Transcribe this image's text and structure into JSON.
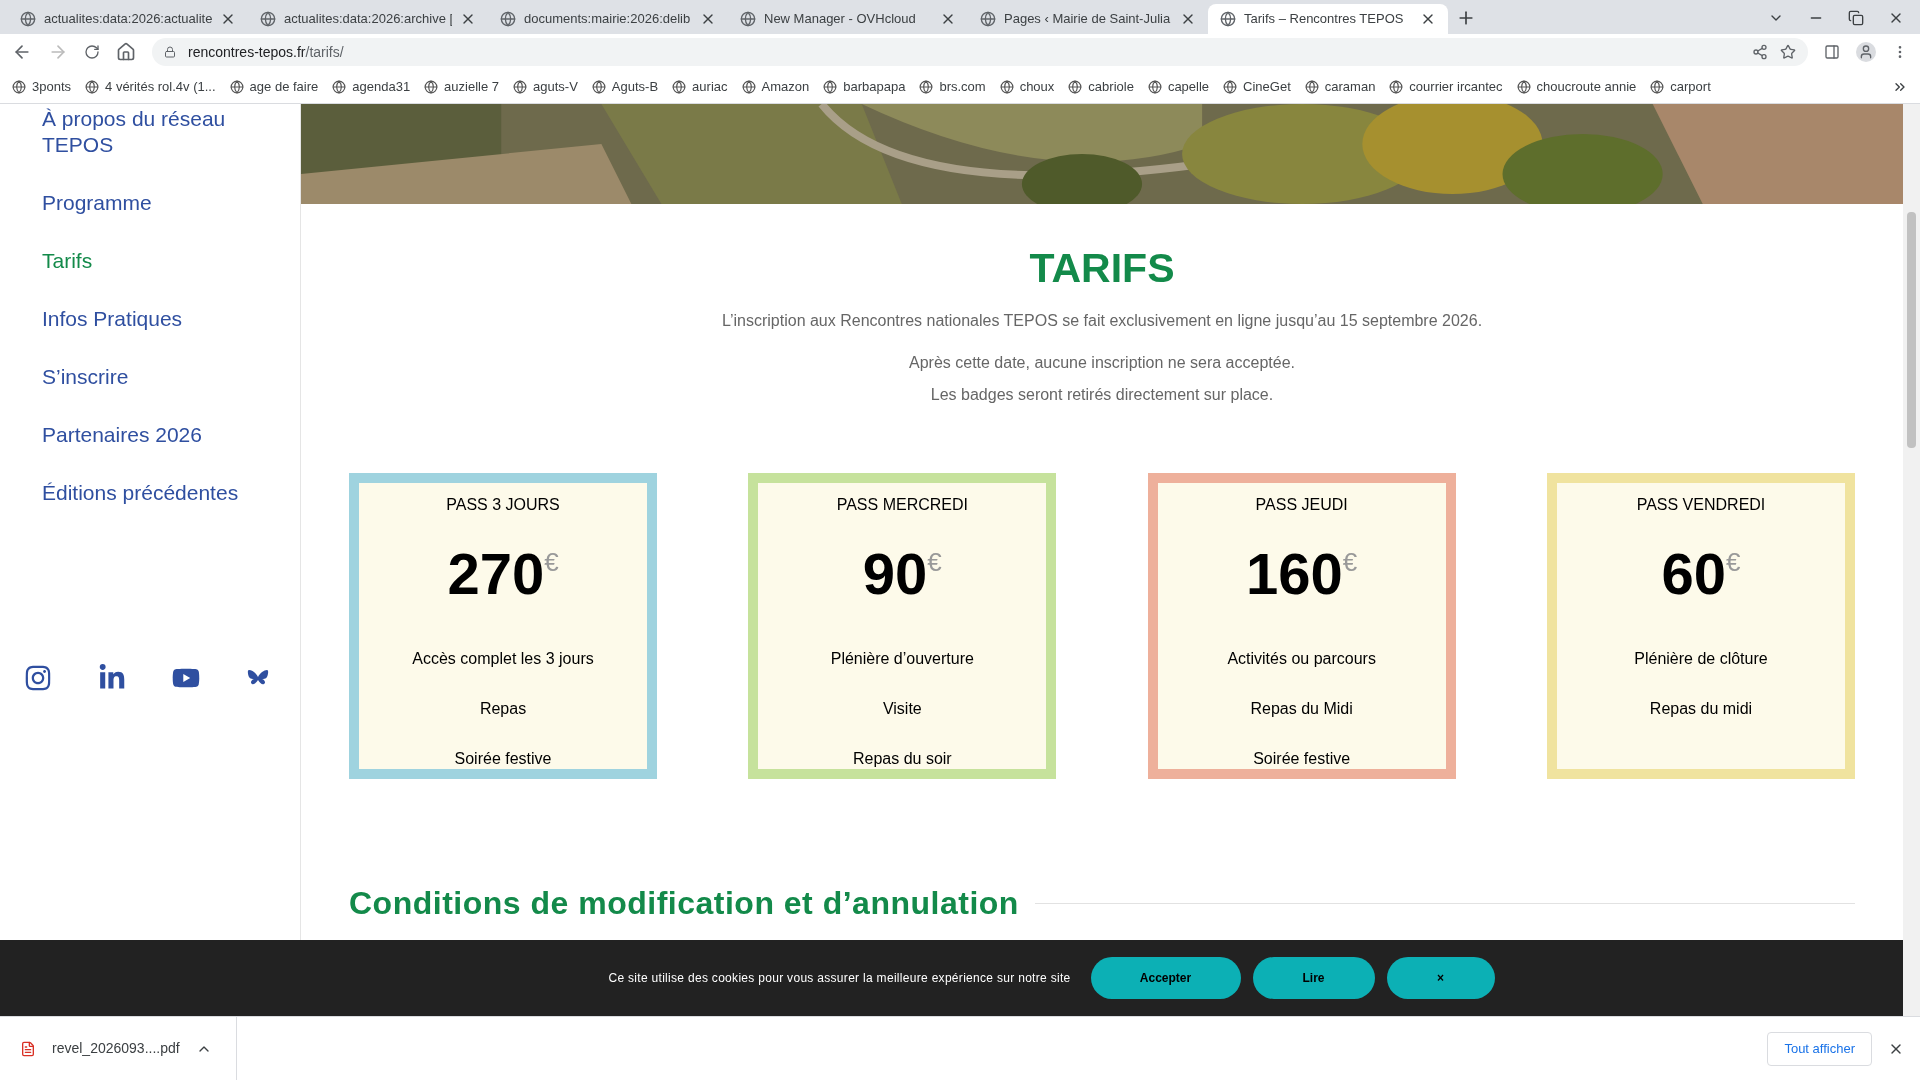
{
  "browser": {
    "tabs": [
      {
        "title": "actualites:data:2026:actualite",
        "selected": false
      },
      {
        "title": "actualites:data:2026:archive [",
        "selected": false
      },
      {
        "title": "documents:mairie:2026:delib",
        "selected": false
      },
      {
        "title": "New Manager - OVHcloud",
        "selected": false
      },
      {
        "title": "Pages ‹ Mairie de Saint-Julia",
        "selected": false
      },
      {
        "title": "Tarifs – Rencontres TEPOS",
        "selected": true
      }
    ],
    "url_host": "rencontres-tepos.fr",
    "url_path": "/tarifs/",
    "bookmarks": [
      "3ponts",
      "4 vérités rol.4v  (1...",
      "age de faire",
      "agenda31",
      "auzielle 7",
      "aguts-V",
      "Aguts-B",
      "auriac",
      "Amazon",
      "barbapapa",
      "brs.com",
      "choux",
      "cabriole",
      "capelle",
      "CineGet",
      "caraman",
      "courrier ircantec",
      "choucroute annie",
      "carport"
    ]
  },
  "sidebar": {
    "items": [
      {
        "label": "À propos du réseau TEPOS",
        "selected": false
      },
      {
        "label": "Programme",
        "selected": false
      },
      {
        "label": "Tarifs",
        "selected": true
      },
      {
        "label": "Infos Pratiques",
        "selected": false
      },
      {
        "label": "S’inscrire",
        "selected": false
      },
      {
        "label": "Partenaires 2026",
        "selected": false
      },
      {
        "label": "Éditions précédentes",
        "selected": false
      }
    ],
    "social": [
      {
        "kind": "instagram"
      },
      {
        "kind": "linkedin"
      },
      {
        "kind": "youtube"
      },
      {
        "kind": "butterfly"
      }
    ]
  },
  "hero": {
    "kind": "picture"
  },
  "title": "TARIFS",
  "intro": [
    "L’inscription aux Rencontres nationales TEPOS se fait exclusivement en ligne jusqu’au 15 septembre 2026.",
    "Après cette date, aucune inscription ne sera acceptée.",
    "Les badges seront retirés directement sur place."
  ],
  "passes": [
    {
      "name": "PASS 3 JOURS",
      "price": "270",
      "currency": "€",
      "color": "#9fd3df",
      "features": [
        "Accès complet les 3 jours",
        "Repas",
        "Soirée festive"
      ]
    },
    {
      "name": "PASS MERCREDI",
      "price": "90",
      "currency": "€",
      "color": "#c6e29c",
      "features": [
        "Plénière d’ouverture",
        "Visite",
        "Repas du soir"
      ]
    },
    {
      "name": "PASS JEUDI",
      "price": "160",
      "currency": "€",
      "color": "#eeb09b",
      "features": [
        "Activités ou parcours",
        "Repas du Midi",
        "Soirée festive"
      ]
    },
    {
      "name": "PASS VENDREDI",
      "price": "60",
      "currency": "€",
      "color": "#f0e39f",
      "features": [
        "Plénière de clôture",
        "Repas du midi"
      ]
    }
  ],
  "conditions": {
    "title": "Conditions de modification et d’annulation"
  },
  "cookie_bar": {
    "message": "Ce site utilise des cookies pour vous assurer la meilleure expérience sur notre site",
    "buttons": [
      "Accepter",
      "Lire",
      "×"
    ]
  },
  "downloads": {
    "file": "revel_2026093....pdf",
    "show_all": "Tout afficher"
  }
}
